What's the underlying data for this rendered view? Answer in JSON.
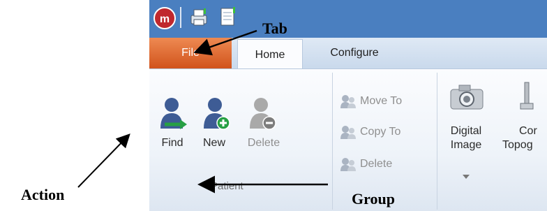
{
  "tabs": {
    "file": "File",
    "home": "Home",
    "configure": "Configure"
  },
  "patient_group": {
    "label": "Patient",
    "actions": {
      "find": "Find",
      "new": "New",
      "delete": "Delete"
    }
  },
  "small_actions": {
    "move_to": "Move To",
    "copy_to": "Copy To",
    "delete": "Delete"
  },
  "devices": {
    "digital_image_line1": "Digital",
    "digital_image_line2": "Image",
    "cut_line1": "Cor",
    "cut_line2": "Topog"
  },
  "annotations": {
    "tab": "Tab",
    "action": "Action",
    "group": "Group"
  },
  "colors": {
    "file_tab": "#e06a2e",
    "titlebar": "#4a7fc0",
    "ribbon_body": "#eef3f9"
  }
}
